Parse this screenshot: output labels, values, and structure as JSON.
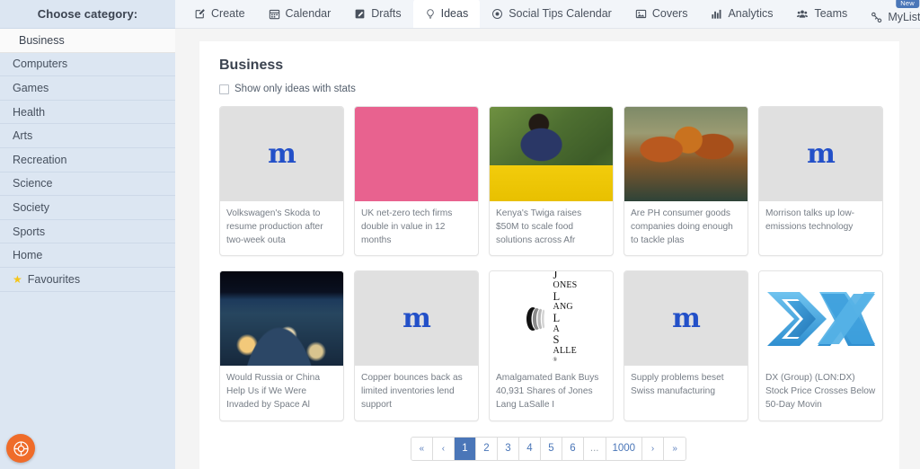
{
  "sidebar": {
    "title": "Choose category:",
    "items": [
      {
        "label": "Business",
        "active": true,
        "star": false
      },
      {
        "label": "Computers",
        "active": false,
        "star": false
      },
      {
        "label": "Games",
        "active": false,
        "star": false
      },
      {
        "label": "Health",
        "active": false,
        "star": false
      },
      {
        "label": "Arts",
        "active": false,
        "star": false
      },
      {
        "label": "Recreation",
        "active": false,
        "star": false
      },
      {
        "label": "Science",
        "active": false,
        "star": false
      },
      {
        "label": "Society",
        "active": false,
        "star": false
      },
      {
        "label": "Sports",
        "active": false,
        "star": false
      },
      {
        "label": "Home",
        "active": false,
        "star": false
      },
      {
        "label": "Favourites",
        "active": false,
        "star": true
      }
    ],
    "help_button": "help-lifering-icon"
  },
  "topnav": {
    "tabs": [
      {
        "label": "Create",
        "icon": "pencil-square-icon",
        "active": false
      },
      {
        "label": "Calendar",
        "icon": "calendar-icon",
        "active": false
      },
      {
        "label": "Drafts",
        "icon": "note-edit-icon",
        "active": false
      },
      {
        "label": "Ideas",
        "icon": "lightbulb-icon",
        "active": true
      },
      {
        "label": "Social Tips Calendar",
        "icon": "target-icon",
        "active": false
      },
      {
        "label": "Covers",
        "icon": "image-icon",
        "active": false
      },
      {
        "label": "Analytics",
        "icon": "bar-chart-icon",
        "active": false
      },
      {
        "label": "Teams",
        "icon": "people-icon",
        "active": false
      },
      {
        "label": "MyList.bio",
        "icon": "link-icon",
        "active": false,
        "badge": "New"
      }
    ]
  },
  "main": {
    "title": "Business",
    "filter_label": "Show only ideas with stats",
    "filter_checked": false,
    "cards": [
      {
        "caption": "Volkswagen's Skoda to resume production after two-week outa",
        "thumb": "placeholder-m-logo"
      },
      {
        "caption": "UK net-zero tech firms double in value in 12 months",
        "thumb": "photo-pink-octopus-plush-toys"
      },
      {
        "caption": "Kenya's Twiga raises $50M to scale food solutions across Afr",
        "thumb": "photo-woman-packing-bananas-yellow-crate"
      },
      {
        "caption": "Are PH consumer goods companies doing enough to tackle plas",
        "thumb": "photo-plastic-bottles-city-composite"
      },
      {
        "caption": "Morrison talks up low-emissions technology",
        "thumb": "placeholder-m-logo"
      },
      {
        "caption": "Would Russia or China Help Us if We Were Invaded by Space Al",
        "thumb": "photo-earth-from-space-at-night"
      },
      {
        "caption": "Copper bounces back as limited inventories lend support",
        "thumb": "placeholder-m-logo"
      },
      {
        "caption": "Amalgamated Bank Buys 40,931 Shares of Jones Lang LaSalle I",
        "thumb": "logo-jones-lang-lasalle"
      },
      {
        "caption": "Supply problems beset Swiss manufacturing",
        "thumb": "placeholder-m-logo"
      },
      {
        "caption": "DX (Group) (LON:DX) Stock Price Crosses Below 50-Day Movin",
        "thumb": "logo-dx-group"
      }
    ],
    "pagination": {
      "first": "«",
      "prev": "‹",
      "pages": [
        "1",
        "2",
        "3",
        "4",
        "5",
        "6"
      ],
      "ellipsis": "...",
      "last_page": "1000",
      "next": "›",
      "last": "»",
      "current": "1"
    }
  },
  "colors": {
    "sidebar_bg": "#dce6f2",
    "accent_blue": "#4a76b8",
    "logo_blue": "#2350c8",
    "help_orange": "#ef6c2a",
    "star_yellow": "#f5c518"
  }
}
